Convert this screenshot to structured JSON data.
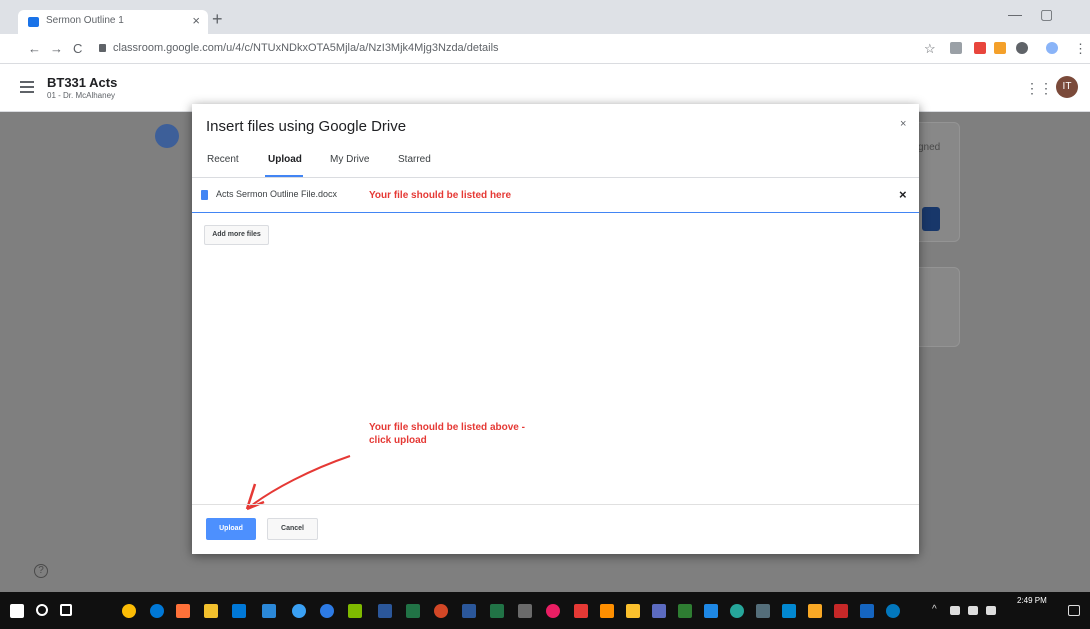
{
  "browser": {
    "tab_title": "Sermon Outline 1",
    "tab_close": "×",
    "new_tab": "+",
    "minimize": "—",
    "maximize": "▢",
    "url": "classroom.google.com/u/4/c/NTUxNDkxOTA5Mjla/a/NzI3Mjk4Mjg3Nzda/details",
    "back": "←",
    "forward": "→",
    "reload": "C",
    "star": "☆",
    "menu": "⋮"
  },
  "classroom": {
    "course_title": "BT331 Acts",
    "course_subtitle": "01 - Dr. McAlhaney",
    "apps_icon": "⋮⋮⋮",
    "avatar_initials": "IT",
    "bg_status_fragment": "gned",
    "help": "?"
  },
  "dialog": {
    "title": "Insert files using Google Drive",
    "close": "×",
    "tabs": [
      "Recent",
      "Upload",
      "My Drive",
      "Starred"
    ],
    "active_tab": "Upload",
    "file_name": "Acts Sermon Outline File.docx",
    "file_remove": "×",
    "add_more_label": "Add more files",
    "upload_label": "Upload",
    "cancel_label": "Cancel"
  },
  "annotations": {
    "top": "Your file should be listed here",
    "bottom": "Your file should be listed above - click upload",
    "color": "#e53935"
  },
  "taskbar": {
    "time": "2:49 PM",
    "chevron": "^"
  }
}
